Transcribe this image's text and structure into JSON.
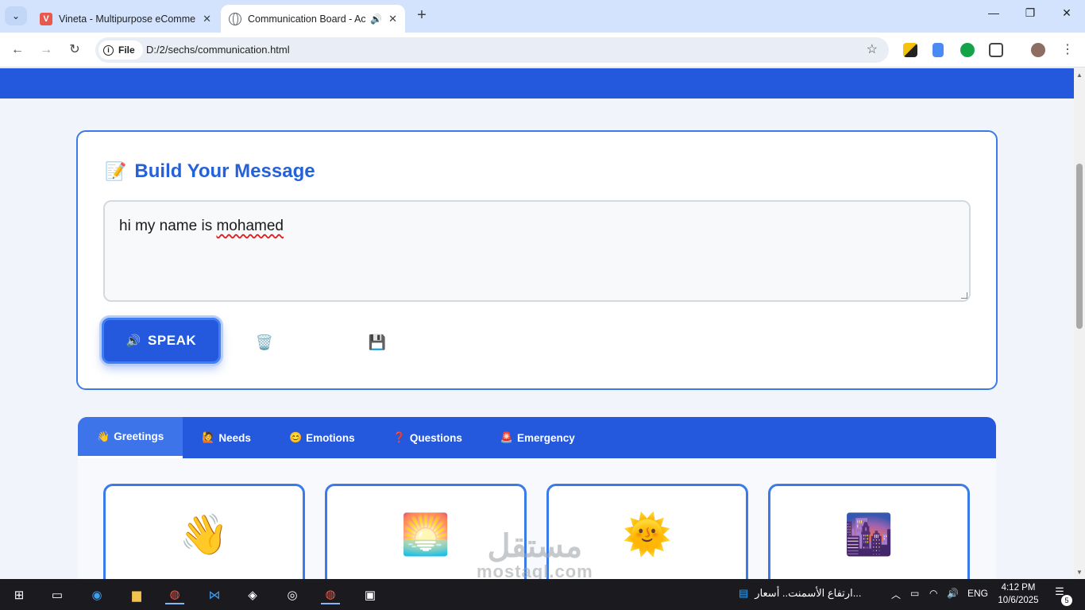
{
  "browser": {
    "tabs": [
      {
        "title": "Vineta - Multipurpose eCommerce",
        "favicon": "V"
      },
      {
        "title": "Communication Board - Accessible",
        "icon": "speaker-icon"
      }
    ],
    "site_chip": "File",
    "url": "D:/2/sechs/communication.html"
  },
  "composer": {
    "title": "Build Your Message",
    "title_icon": "📝",
    "message_value": "hi my name is",
    "message_misspelled": "mohamed",
    "speak_label": "SPEAK",
    "speak_icon": "🔊",
    "clear_icon": "🗑️",
    "save_icon": "💾"
  },
  "categories": [
    {
      "emoji": "👋",
      "label": "Greetings",
      "active": true
    },
    {
      "emoji": "🙋",
      "label": "Needs",
      "active": false
    },
    {
      "emoji": "😊",
      "label": "Emotions",
      "active": false
    },
    {
      "emoji": "❓",
      "label": "Questions",
      "active": false
    },
    {
      "emoji": "🚨",
      "label": "Emergency",
      "active": false
    }
  ],
  "cards": [
    {
      "emoji": "👋"
    },
    {
      "emoji": "🌅"
    },
    {
      "emoji": "🌞"
    },
    {
      "emoji": "🌆"
    }
  ],
  "watermark": {
    "arabic": "مستقل",
    "latin": "mostaql.com"
  },
  "taskbar": {
    "news": "ارتفاع الأسمنت.. أسعار...",
    "language": "ENG",
    "time": "4:12 PM",
    "date": "10/6/2025",
    "notification_count": "5"
  },
  "colors": {
    "primary": "#2458dd",
    "accent_border": "#3a7be8",
    "title": "#2562d8"
  }
}
